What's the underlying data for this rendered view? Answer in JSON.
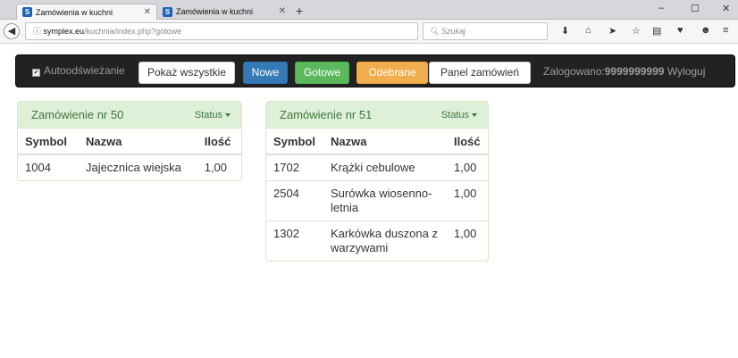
{
  "browser": {
    "tabs": [
      {
        "label": "Zamówienia w kuchni",
        "favicon": "S"
      },
      {
        "label": "Zamówienia w kuchni",
        "favicon": "S"
      }
    ],
    "new_tab": "+",
    "url_prefix": "symplex.eu",
    "url_rest": "/kuchnia/index.php?gotowe",
    "search_placeholder": "Szukaj",
    "window_controls": {
      "minimize": "–",
      "maximize": "☐",
      "close": "✕"
    }
  },
  "appbar": {
    "autorefresh_label": "Autoodświeżanie",
    "autorefresh_checked": true,
    "buttons": [
      {
        "label": "Pokaż wszystkie",
        "style": "default"
      },
      {
        "label": "Nowe",
        "style": "primary"
      },
      {
        "label": "Gotowe",
        "style": "success"
      },
      {
        "label": "Odebrane",
        "style": "warning"
      },
      {
        "label": "Panel zamówień",
        "style": "default"
      }
    ],
    "login_prefix": "Zalogowano:",
    "login_user": "9999999999",
    "logout_label": "Wyloguj"
  },
  "columns": {
    "symbol": "Symbol",
    "name": "Nazwa",
    "qty": "Ilość"
  },
  "orders": [
    {
      "title": "Zamówienie nr 50",
      "status": "Status",
      "rows": [
        {
          "symbol": "1004",
          "name": "Jajecznica wiejska",
          "qty": "1,00"
        }
      ]
    },
    {
      "title": "Zamówienie nr 51",
      "status": "Status",
      "rows": [
        {
          "symbol": "1702",
          "name": "Krążki cebulowe",
          "qty": "1,00"
        },
        {
          "symbol": "2504",
          "name": "Surówka wiosenno-letnia",
          "qty": "1,00"
        },
        {
          "symbol": "1302",
          "name": "Karkówka duszona z warzywami",
          "qty": "1,00"
        }
      ]
    }
  ],
  "colors": {
    "panel_heading": "#dff0d8",
    "panel_text": "#3c763d",
    "navbar": "#222222"
  }
}
